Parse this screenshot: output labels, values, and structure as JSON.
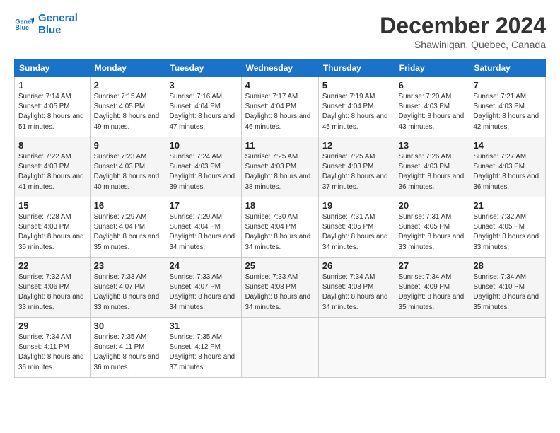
{
  "logo": {
    "line1": "General",
    "line2": "Blue"
  },
  "title": "December 2024",
  "subtitle": "Shawinigan, Quebec, Canada",
  "days_of_week": [
    "Sunday",
    "Monday",
    "Tuesday",
    "Wednesday",
    "Thursday",
    "Friday",
    "Saturday"
  ],
  "weeks": [
    [
      {
        "day": "1",
        "sunrise": "7:14 AM",
        "sunset": "4:05 PM",
        "daylight": "8 hours and 51 minutes."
      },
      {
        "day": "2",
        "sunrise": "7:15 AM",
        "sunset": "4:05 PM",
        "daylight": "8 hours and 49 minutes."
      },
      {
        "day": "3",
        "sunrise": "7:16 AM",
        "sunset": "4:04 PM",
        "daylight": "8 hours and 47 minutes."
      },
      {
        "day": "4",
        "sunrise": "7:17 AM",
        "sunset": "4:04 PM",
        "daylight": "8 hours and 46 minutes."
      },
      {
        "day": "5",
        "sunrise": "7:19 AM",
        "sunset": "4:04 PM",
        "daylight": "8 hours and 45 minutes."
      },
      {
        "day": "6",
        "sunrise": "7:20 AM",
        "sunset": "4:03 PM",
        "daylight": "8 hours and 43 minutes."
      },
      {
        "day": "7",
        "sunrise": "7:21 AM",
        "sunset": "4:03 PM",
        "daylight": "8 hours and 42 minutes."
      }
    ],
    [
      {
        "day": "8",
        "sunrise": "7:22 AM",
        "sunset": "4:03 PM",
        "daylight": "8 hours and 41 minutes."
      },
      {
        "day": "9",
        "sunrise": "7:23 AM",
        "sunset": "4:03 PM",
        "daylight": "8 hours and 40 minutes."
      },
      {
        "day": "10",
        "sunrise": "7:24 AM",
        "sunset": "4:03 PM",
        "daylight": "8 hours and 39 minutes."
      },
      {
        "day": "11",
        "sunrise": "7:25 AM",
        "sunset": "4:03 PM",
        "daylight": "8 hours and 38 minutes."
      },
      {
        "day": "12",
        "sunrise": "7:25 AM",
        "sunset": "4:03 PM",
        "daylight": "8 hours and 37 minutes."
      },
      {
        "day": "13",
        "sunrise": "7:26 AM",
        "sunset": "4:03 PM",
        "daylight": "8 hours and 36 minutes."
      },
      {
        "day": "14",
        "sunrise": "7:27 AM",
        "sunset": "4:03 PM",
        "daylight": "8 hours and 36 minutes."
      }
    ],
    [
      {
        "day": "15",
        "sunrise": "7:28 AM",
        "sunset": "4:03 PM",
        "daylight": "8 hours and 35 minutes."
      },
      {
        "day": "16",
        "sunrise": "7:29 AM",
        "sunset": "4:04 PM",
        "daylight": "8 hours and 35 minutes."
      },
      {
        "day": "17",
        "sunrise": "7:29 AM",
        "sunset": "4:04 PM",
        "daylight": "8 hours and 34 minutes."
      },
      {
        "day": "18",
        "sunrise": "7:30 AM",
        "sunset": "4:04 PM",
        "daylight": "8 hours and 34 minutes."
      },
      {
        "day": "19",
        "sunrise": "7:31 AM",
        "sunset": "4:05 PM",
        "daylight": "8 hours and 34 minutes."
      },
      {
        "day": "20",
        "sunrise": "7:31 AM",
        "sunset": "4:05 PM",
        "daylight": "8 hours and 33 minutes."
      },
      {
        "day": "21",
        "sunrise": "7:32 AM",
        "sunset": "4:05 PM",
        "daylight": "8 hours and 33 minutes."
      }
    ],
    [
      {
        "day": "22",
        "sunrise": "7:32 AM",
        "sunset": "4:06 PM",
        "daylight": "8 hours and 33 minutes."
      },
      {
        "day": "23",
        "sunrise": "7:33 AM",
        "sunset": "4:07 PM",
        "daylight": "8 hours and 33 minutes."
      },
      {
        "day": "24",
        "sunrise": "7:33 AM",
        "sunset": "4:07 PM",
        "daylight": "8 hours and 34 minutes."
      },
      {
        "day": "25",
        "sunrise": "7:33 AM",
        "sunset": "4:08 PM",
        "daylight": "8 hours and 34 minutes."
      },
      {
        "day": "26",
        "sunrise": "7:34 AM",
        "sunset": "4:08 PM",
        "daylight": "8 hours and 34 minutes."
      },
      {
        "day": "27",
        "sunrise": "7:34 AM",
        "sunset": "4:09 PM",
        "daylight": "8 hours and 35 minutes."
      },
      {
        "day": "28",
        "sunrise": "7:34 AM",
        "sunset": "4:10 PM",
        "daylight": "8 hours and 35 minutes."
      }
    ],
    [
      {
        "day": "29",
        "sunrise": "7:34 AM",
        "sunset": "4:11 PM",
        "daylight": "8 hours and 36 minutes."
      },
      {
        "day": "30",
        "sunrise": "7:35 AM",
        "sunset": "4:11 PM",
        "daylight": "8 hours and 36 minutes."
      },
      {
        "day": "31",
        "sunrise": "7:35 AM",
        "sunset": "4:12 PM",
        "daylight": "8 hours and 37 minutes."
      },
      null,
      null,
      null,
      null
    ]
  ],
  "labels": {
    "sunrise": "Sunrise:",
    "sunset": "Sunset:",
    "daylight": "Daylight:"
  }
}
